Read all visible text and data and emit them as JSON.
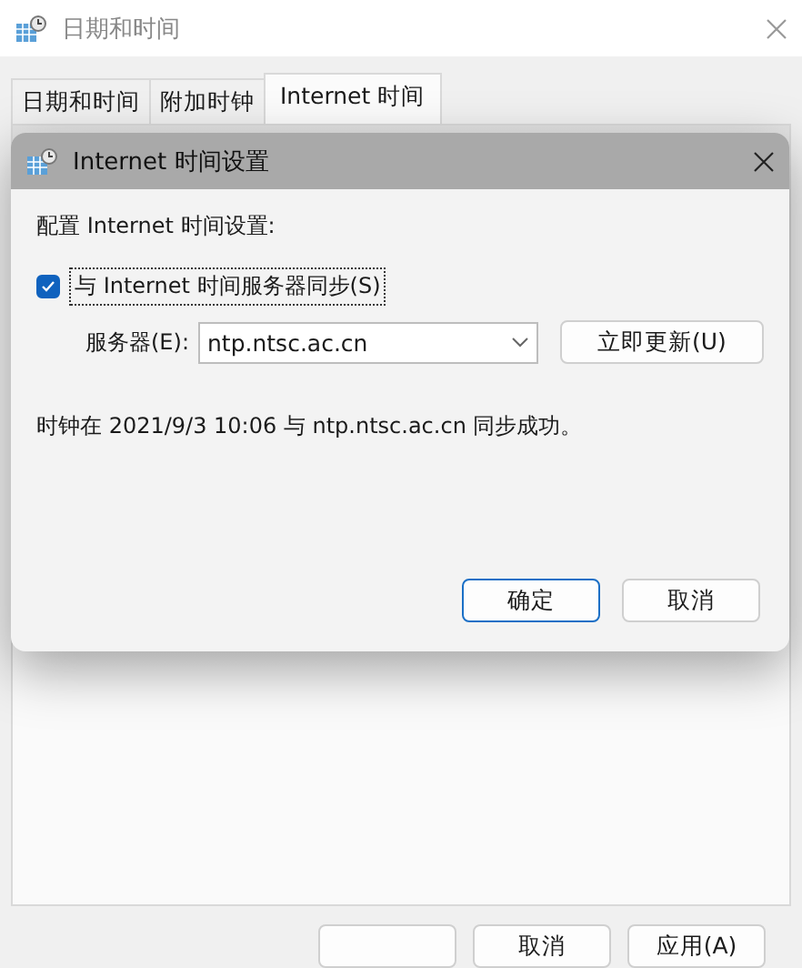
{
  "window": {
    "title": "日期和时间"
  },
  "tabs": [
    {
      "label": "日期和时间",
      "selected": false
    },
    {
      "label": "附加时钟",
      "selected": false
    },
    {
      "label": "Internet 时间",
      "selected": true
    }
  ],
  "buttons": [
    {
      "label": "取消"
    },
    {
      "label": "应用(A)"
    }
  ],
  "dialog": {
    "title": "Internet 时间设置",
    "heading": "配置 Internet 时间设置:",
    "sync": {
      "label": "与 Internet 时间服务器同步(S)",
      "checked": true
    },
    "server_label": "服务器(E):",
    "server": "ntp.ntsc.ac.cn",
    "update_button": "立即更新(U)",
    "status": "时钟在 2021/9/3 10:06 与 ntp.ntsc.ac.cn 同步成功。",
    "buttons": [
      {
        "label": "确定",
        "default": true
      },
      {
        "label": "取消",
        "default": false
      }
    ]
  }
}
